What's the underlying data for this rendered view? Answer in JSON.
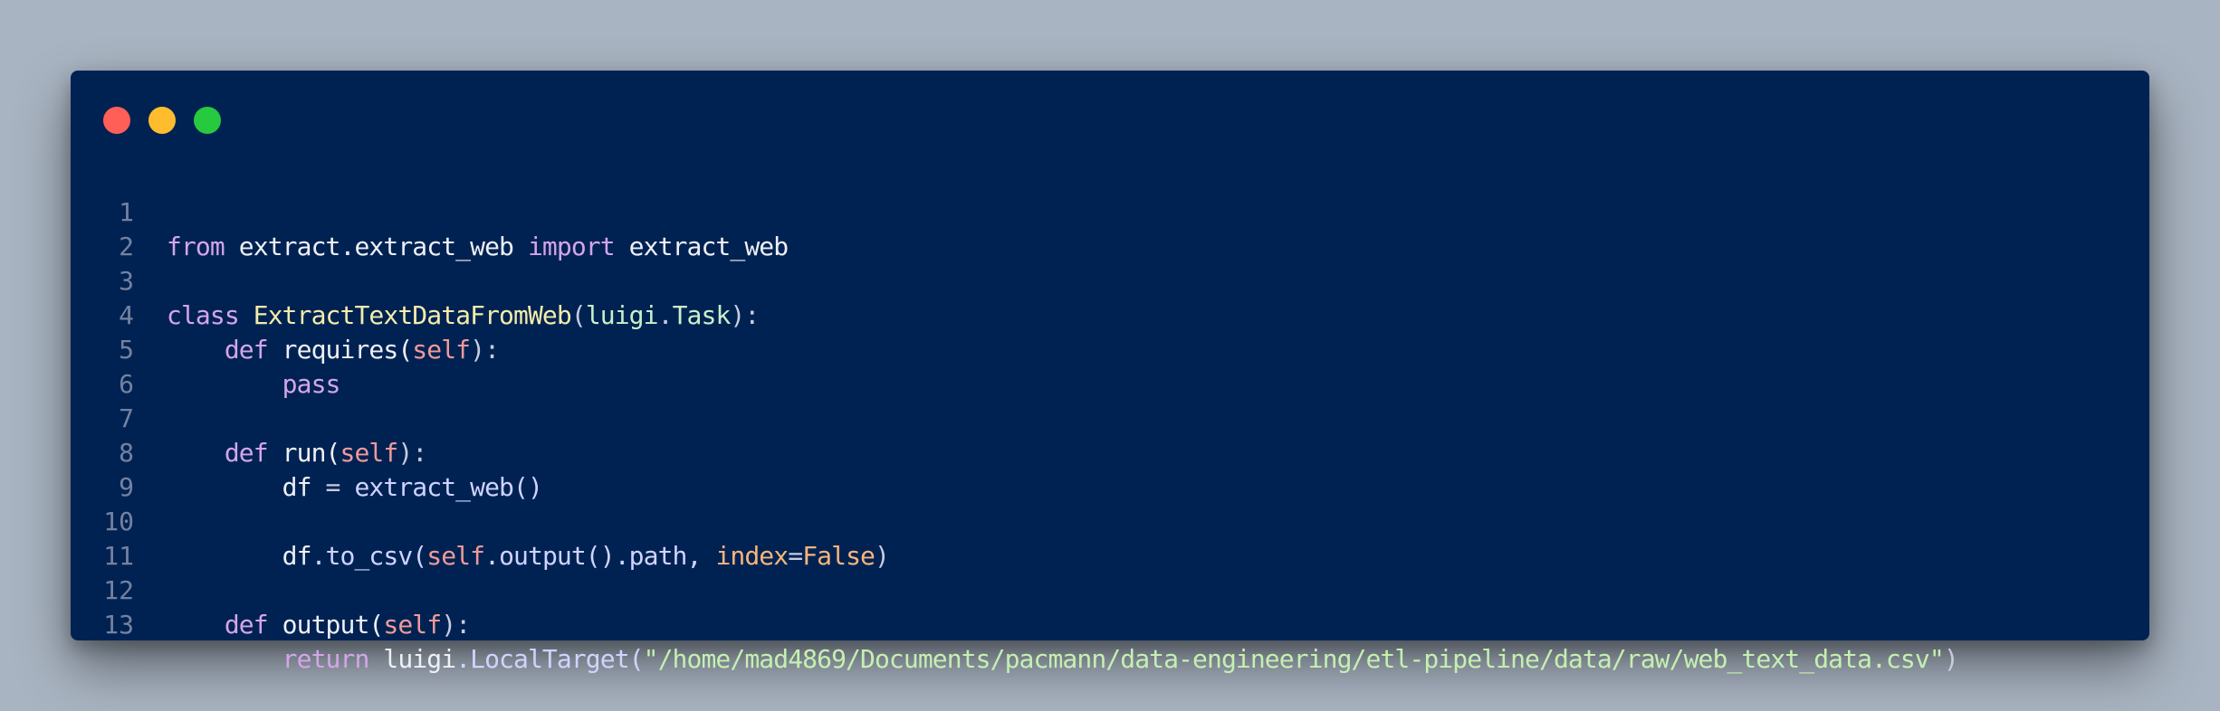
{
  "lines": [
    {
      "n": "1",
      "t": [
        "from",
        " extract.extract_web ",
        "import",
        " extract_web"
      ]
    },
    {
      "n": "2",
      "t": []
    },
    {
      "n": "3",
      "t": [
        "class",
        " ",
        "ExtractTextDataFromWeb",
        "(",
        "luigi",
        ".",
        "Task",
        "):"
      ]
    },
    {
      "n": "4",
      "t": [
        "    ",
        "def",
        " requires(",
        "self",
        "):"
      ]
    },
    {
      "n": "5",
      "t": [
        "        ",
        "pass"
      ]
    },
    {
      "n": "6",
      "t": []
    },
    {
      "n": "7",
      "t": [
        "    ",
        "def",
        " run(",
        "self",
        "):"
      ]
    },
    {
      "n": "8",
      "t": [
        "        ",
        "df",
        " = ",
        "extract_web()"
      ]
    },
    {
      "n": "9",
      "t": []
    },
    {
      "n": "10",
      "t": [
        "        ",
        "df",
        ".to_csv(",
        "self",
        ".output().path, ",
        "index",
        "=",
        "False",
        ")"
      ]
    },
    {
      "n": "11",
      "t": []
    },
    {
      "n": "12",
      "t": [
        "    ",
        "def",
        " output(",
        "self",
        "):"
      ]
    },
    {
      "n": "13",
      "t": [
        "        ",
        "return",
        " ",
        "luigi",
        ".LocalTarget(",
        "\"/home/mad4869/Documents/pacmann/data-engineering/etl-pipeline/data/raw/web_text_data.csv\"",
        ")"
      ]
    }
  ]
}
